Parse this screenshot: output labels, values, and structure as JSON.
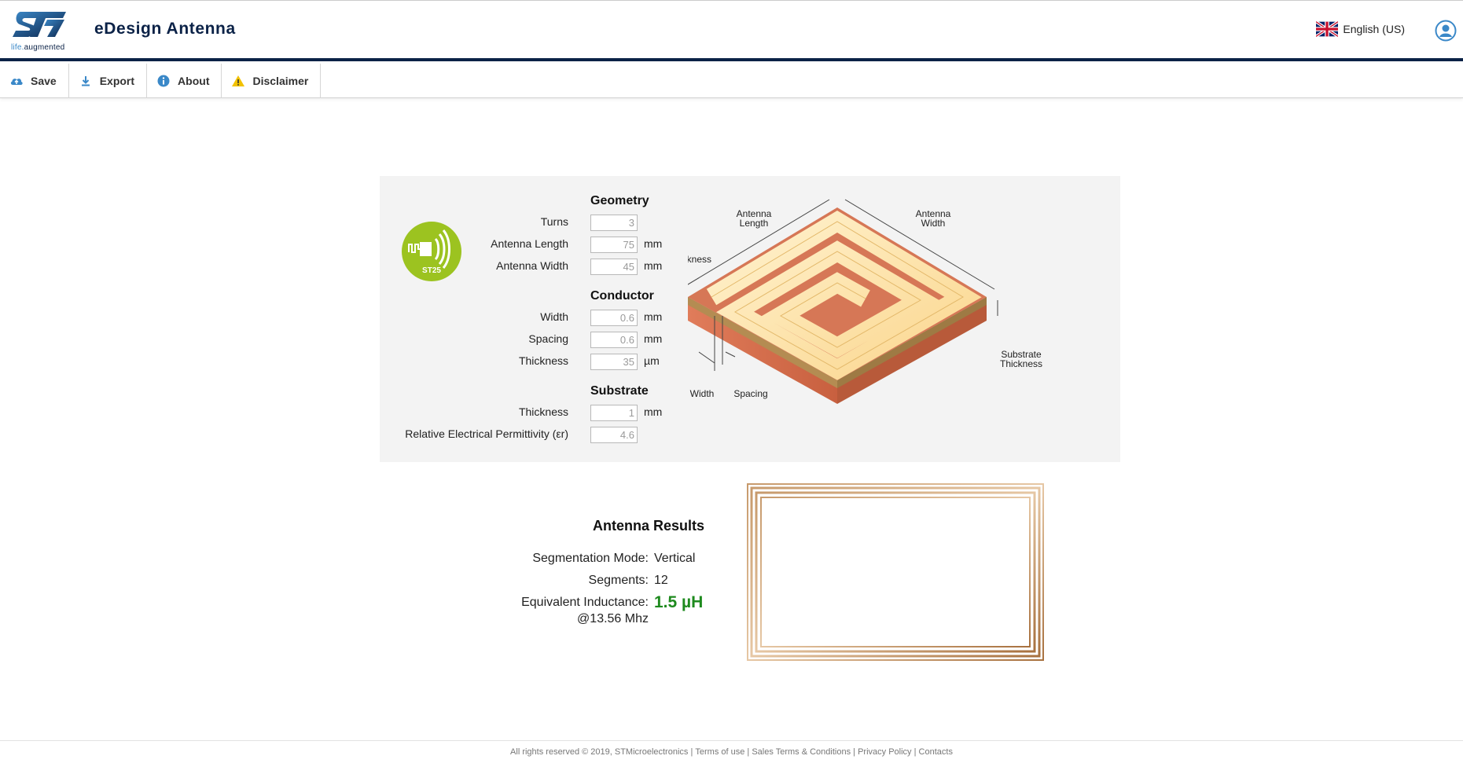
{
  "header": {
    "logo_tagline_prefix": "life.",
    "logo_tagline_suffix": "augmented",
    "app_title": "eDesign Antenna",
    "language": "English (US)"
  },
  "toolbar": {
    "save": "Save",
    "export": "Export",
    "about": "About",
    "disclaimer": "Disclaimer"
  },
  "config": {
    "logo_text": "ST25",
    "geometry": {
      "title": "Geometry",
      "turns_label": "Turns",
      "turns_value": "3",
      "length_label": "Antenna Length",
      "length_value": "75",
      "length_unit": "mm",
      "width_label": "Antenna Width",
      "width_value": "45",
      "width_unit": "mm"
    },
    "conductor": {
      "title": "Conductor",
      "width_label": "Width",
      "width_value": "0.6",
      "width_unit": "mm",
      "spacing_label": "Spacing",
      "spacing_value": "0.6",
      "spacing_unit": "mm",
      "thickness_label": "Thickness",
      "thickness_value": "35",
      "thickness_unit": "µm"
    },
    "substrate": {
      "title": "Substrate",
      "thickness_label": "Thickness",
      "thickness_value": "1",
      "thickness_unit": "mm",
      "permittivity_label": "Relative Electrical Permittivity (εr)",
      "permittivity_value": "4.6"
    },
    "diagram": {
      "antenna_length": [
        "Antenna",
        "Length"
      ],
      "antenna_width": [
        "Antenna",
        "Width"
      ],
      "thickness": "Thickness",
      "substrate_thickness": [
        "Substrate",
        "Thickness"
      ],
      "width": "Width",
      "spacing": "Spacing"
    }
  },
  "results": {
    "title": "Antenna Results",
    "segmentation_label": "Segmentation Mode:",
    "segmentation_value": "Vertical",
    "segments_label": "Segments:",
    "segments_value": "12",
    "inductance_label": "Equivalent Inductance:",
    "inductance_value": "1.5 µH",
    "frequency": "@13.56 Mhz"
  },
  "footer": {
    "copyright": "All rights reserved © 2019, STMicroelectronics",
    "terms": "Terms of use",
    "sales": "Sales Terms & Conditions",
    "privacy": "Privacy Policy",
    "contacts": "Contacts",
    "separator": " | "
  },
  "colors": {
    "brand_navy": "#0b2247",
    "brand_blue": "#3a88c8",
    "st25_green": "#9cc320",
    "inductance_green": "#1e8a1e",
    "copper": "#d0704f",
    "conductor_cream": "#fde6ad"
  }
}
